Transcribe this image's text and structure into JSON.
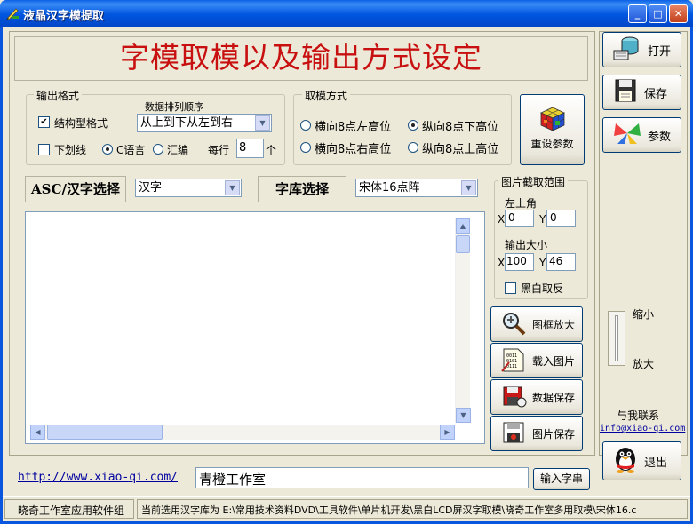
{
  "window": {
    "title": "液晶汉字模提取",
    "min": "_",
    "max": "□",
    "close": "✕"
  },
  "banner": {
    "text": "字模取模以及输出方式设定",
    "color": "#C81010"
  },
  "output_format": {
    "label": "输出格式",
    "order_label": "数据排列顺序",
    "struct_label": "结构型格式",
    "struct_checked": "✔",
    "order_value": "从上到下从左到右",
    "underline_label": "下划线",
    "c_label": "C语言",
    "asm_label": "汇编",
    "per_row_label": "每行",
    "per_row_value": "8",
    "per_row_unit": "个"
  },
  "mode": {
    "label": "取模方式",
    "opt1": "横向8点左高位",
    "opt2": "纵向8点下高位",
    "opt3": "横向8点右高位",
    "opt4": "纵向8点上高位"
  },
  "reset_button": "重设参数",
  "asc_select": {
    "label": "ASC/汉字选择",
    "value": "汉字"
  },
  "font_select": {
    "label": "字库选择",
    "value": "宋体16点阵"
  },
  "crop": {
    "label": "图片截取范围",
    "top_left": "左上角",
    "x_label": "X",
    "y_label": "Y",
    "x1": "0",
    "y1": "0",
    "size_label": "输出大小",
    "x2": "100",
    "y2": "46",
    "invert_label": "黑白取反"
  },
  "actions": {
    "zoom": "图框放大",
    "load": "载入图片",
    "save_data": "数据保存",
    "save_image": "图片保存"
  },
  "toolbar": {
    "open": "打开",
    "save": "保存",
    "params": "参数",
    "exit": "退出"
  },
  "zoom": {
    "small": "缩小",
    "big": "放大"
  },
  "contact": {
    "label": "与我联系",
    "email": "info@xiao-qi.com"
  },
  "bottom": {
    "url": "http://www.xiao-qi.com/",
    "input_value": "青橙工作室",
    "input_button": "输入字串"
  },
  "status": {
    "left": "晓奇工作室应用软件组",
    "right": "当前选用汉字库为 E:\\常用技术资料DVD\\工具软件\\单片机开发\\黑白LCD屏汉字取模\\晓奇工作室多用取模\\宋体16.c"
  }
}
